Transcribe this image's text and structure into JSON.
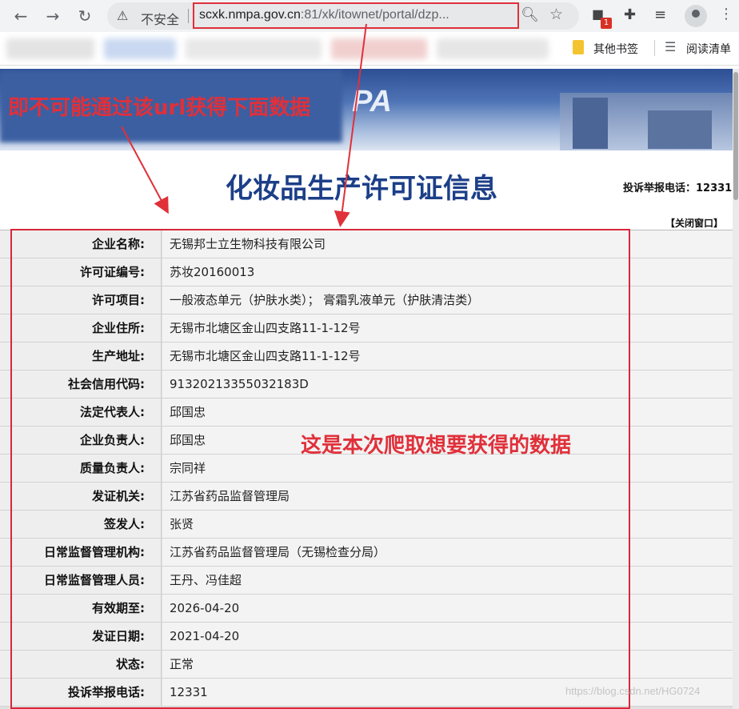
{
  "browser": {
    "security_label": "不安全",
    "url_host": "scxk.nmpa.gov.cn",
    "url_rest": ":81/xk/itownet/portal/dzp...",
    "extension_badge": "1",
    "bookmarks": {
      "other_bookmarks": "其他书签",
      "reading_list": "阅读清单"
    }
  },
  "page": {
    "title": "化妆品生产许可证信息",
    "hotline_top": "投诉举报电话：12331",
    "close_window": "【关闭窗口】",
    "banner_logo_partial": "PA"
  },
  "annotations": {
    "top": "即不可能通过该url获得下面数据",
    "middle": "这是本次爬取想要获得的数据",
    "watermark": "https://blog.csdn.net/HG0724"
  },
  "rows": [
    {
      "label": "企业名称:",
      "value": "无锡邦士立生物科技有限公司"
    },
    {
      "label": "许可证编号:",
      "value": "苏妆20160013"
    },
    {
      "label": "许可项目:",
      "value": "一般液态单元（护肤水类）； 膏霜乳液单元（护肤清洁类）"
    },
    {
      "label": "企业住所:",
      "value": "无锡市北塘区金山四支路11-1-12号"
    },
    {
      "label": "生产地址:",
      "value": "无锡市北塘区金山四支路11-1-12号"
    },
    {
      "label": "社会信用代码:",
      "value": "91320213355032183D"
    },
    {
      "label": "法定代表人:",
      "value": "邱国忠"
    },
    {
      "label": "企业负责人:",
      "value": "邱国忠"
    },
    {
      "label": "质量负责人:",
      "value": "宗同祥"
    },
    {
      "label": "发证机关:",
      "value": "江苏省药品监督管理局"
    },
    {
      "label": "签发人:",
      "value": "张贤"
    },
    {
      "label": "日常监督管理机构:",
      "value": "江苏省药品监督管理局（无锡检查分局）"
    },
    {
      "label": "日常监督管理人员:",
      "value": "王丹、冯佳超"
    },
    {
      "label": "有效期至:",
      "value": "2026-04-20"
    },
    {
      "label": "发证日期:",
      "value": "2021-04-20"
    },
    {
      "label": "状态:",
      "value": "正常"
    },
    {
      "label": "投诉举报电话:",
      "value": "12331"
    }
  ]
}
